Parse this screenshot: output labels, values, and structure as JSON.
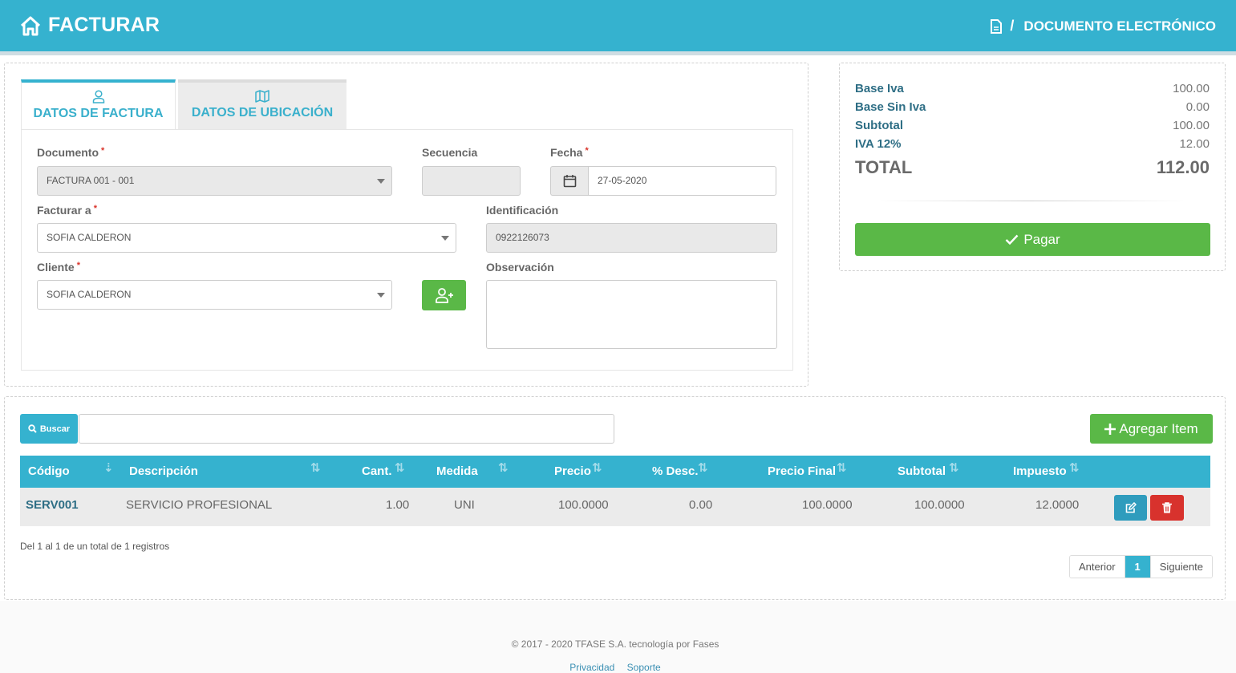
{
  "header": {
    "title": "FACTURAR",
    "breadcrumb_sep": "/",
    "breadcrumb": "DOCUMENTO ELECTRÓNICO"
  },
  "tabs": [
    {
      "label": "DATOS DE FACTURA",
      "icon": "user-icon",
      "active": true
    },
    {
      "label": "DATOS DE UBICACIÓN",
      "icon": "map-icon",
      "active": false
    }
  ],
  "form": {
    "required_mark": "*",
    "documento": {
      "label": "Documento",
      "value": "FACTURA 001 - 001"
    },
    "secuencia": {
      "label": "Secuencia",
      "value": ""
    },
    "fecha": {
      "label": "Fecha",
      "value": "27-05-2020"
    },
    "facturar_a": {
      "label": "Facturar a",
      "value": "SOFIA CALDERON"
    },
    "identificacion": {
      "label": "Identificación",
      "value": "0922126073"
    },
    "cliente": {
      "label": "Cliente",
      "value": "SOFIA CALDERON"
    },
    "observacion": {
      "label": "Observación",
      "value": ""
    }
  },
  "totals": {
    "rows": [
      {
        "label": "Base Iva",
        "value": "100.00"
      },
      {
        "label": "Base Sin Iva",
        "value": "0.00"
      },
      {
        "label": "Subtotal",
        "value": "100.00"
      },
      {
        "label": "IVA 12%",
        "value": "12.00"
      }
    ],
    "total_label": "TOTAL",
    "total_value": "112.00",
    "pay_label": "Pagar"
  },
  "toolbar": {
    "search_label": "Buscar",
    "search_value": "",
    "add_label": "Agregar Item"
  },
  "table": {
    "columns": [
      "Código",
      "Descripción",
      "Cant.",
      "Medida",
      "Precio",
      "% Desc.",
      "Precio Final",
      "Subtotal",
      "Impuesto"
    ],
    "rows": [
      {
        "codigo": "SERV001",
        "descripcion": "SERVICIO PROFESIONAL",
        "cant": "1.00",
        "medida": "UNI",
        "precio": "100.0000",
        "desc": "0.00",
        "precio_final": "100.0000",
        "subtotal": "100.0000",
        "impuesto": "12.0000"
      }
    ],
    "info": "Del 1 al 1 de un total de 1 registros"
  },
  "pagination": {
    "prev": "Anterior",
    "current": "1",
    "next": "Siguiente"
  },
  "footer": {
    "copyright": "© 2017 - 2020 TFASE S.A. tecnología por Fases",
    "links": [
      "Privacidad",
      "Soporte"
    ]
  },
  "colors": {
    "primary": "#35b2cf",
    "success": "#5ab847",
    "danger": "#d8322d",
    "dark_text": "#2e6e85"
  }
}
